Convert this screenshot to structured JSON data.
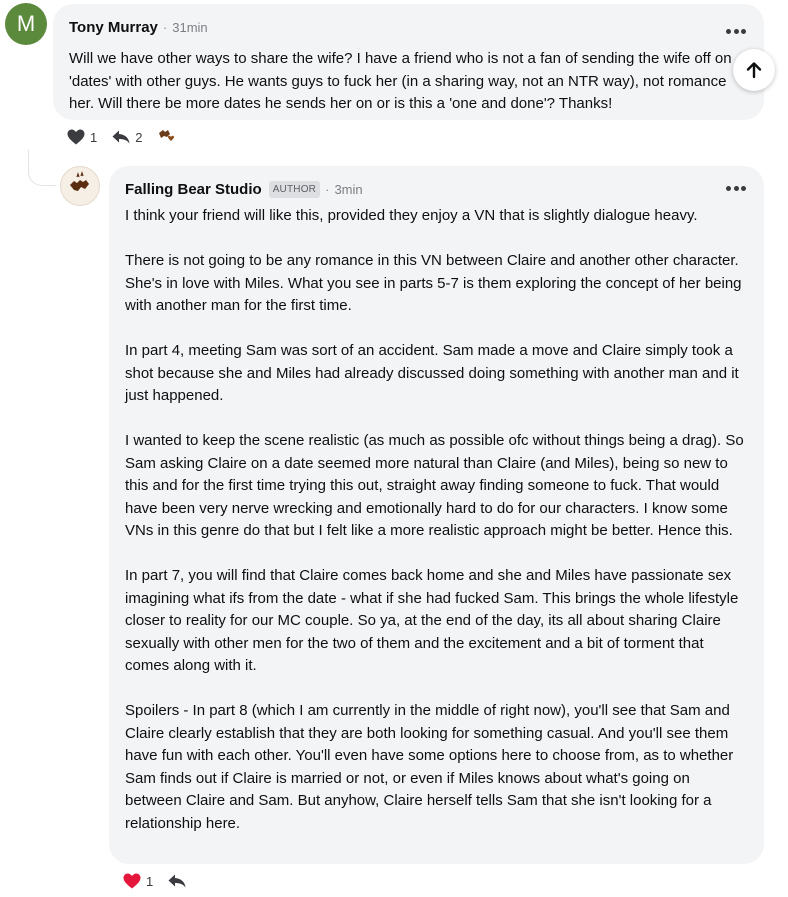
{
  "comment1": {
    "avatar_letter": "M",
    "avatar_color": "#5b8a3c",
    "author": "Tony Murray",
    "separator": "·",
    "time": "31min",
    "text": "Will we have other ways to share the wife? I have a friend who is not a fan of sending the wife off on 'dates' with other guys. He wants guys to fuck her (in a sharing way, not an NTR way), not romance her. Will there be more dates he sends her on or is this a 'one and done'? Thanks!",
    "likes": "1",
    "replies": "2",
    "heart_icon": "heart-outline-icon",
    "reply_icon": "reply-arrow-icon"
  },
  "comment2": {
    "author": "Falling Bear Studio",
    "badge": "AUTHOR",
    "separator": "·",
    "time": "3min",
    "paragraphs": [
      "I think your friend will like this, provided they enjoy a VN that is slightly dialogue heavy.",
      "There is not going to be any romance in this VN between Claire and another other character. She's in love with Miles. What you see in parts 5-7 is them exploring the concept of her being with another man for the first time.",
      "In part 4, meeting Sam was sort of an accident. Sam made a move and Claire simply took a shot because she and Miles had already discussed doing something with another man and it just happened.",
      "I wanted to keep the scene realistic (as much as possible ofc without things being a drag). So Sam asking Claire on a date seemed more natural than Claire (and Miles), being so new to this and for the first time trying this out, straight away finding someone to fuck. That would have been very nerve wrecking and emotionally hard to do for our characters. I know some VNs in this genre do that but I felt like a more realistic approach might be better. Hence this.",
      "In part 7, you will find that Claire comes back home and she and Miles have passionate sex imagining what ifs from the date - what if she had fucked Sam. This brings the whole lifestyle closer to reality for our MC couple. So ya, at the end of the day, its all about sharing Claire sexually with other men for the two of them and the excitement and a bit of torment that comes along with it.",
      "Spoilers - In part 8 (which I am currently in the middle of right now), you'll see that Sam and Claire clearly establish that they are both looking for something casual. And you'll see them have fun with each other. You'll even have some options here to choose from, as to whether Sam finds out if Claire is married or not, or even if Miles knows about what's going on between Claire and Sam. But anyhow, Claire herself tells Sam that she isn't looking for a relationship here."
    ],
    "likes": "1",
    "heart_color": "#e5163b",
    "heart_icon": "heart-filled-icon",
    "reply_icon": "reply-arrow-icon"
  },
  "colors": {
    "bubble": "#f3f4f6",
    "text": "#0e0f10",
    "muted": "#7b7e83"
  }
}
